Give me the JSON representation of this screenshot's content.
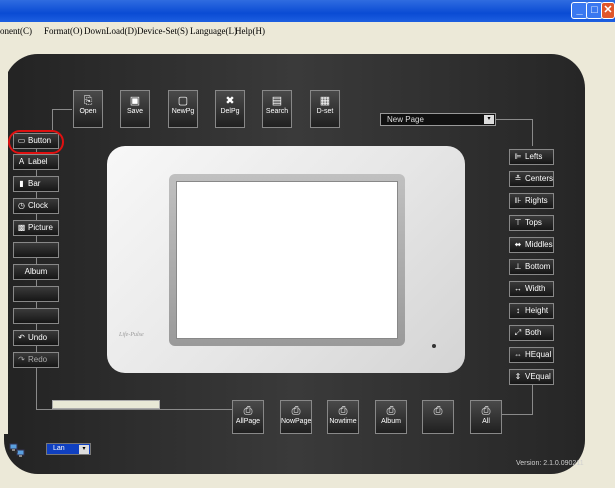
{
  "titlebar": {
    "min": "_",
    "max": "□",
    "close": "✕"
  },
  "menu": [
    "onent(C)",
    "Format(O)",
    "DownLoad(D)",
    "Device-Set(S)",
    "Language(L)",
    "Help(H)"
  ],
  "toolbar_top": [
    {
      "label": "Open",
      "icon": "⎘"
    },
    {
      "label": "Save",
      "icon": "▣"
    },
    {
      "label": "NewPg",
      "icon": "▢"
    },
    {
      "label": "DelPg",
      "icon": "✖"
    },
    {
      "label": "Search",
      "icon": "▤"
    },
    {
      "label": "D-set",
      "icon": "▦"
    }
  ],
  "page_select": {
    "value": "New Page",
    "arrow": "▾"
  },
  "left_items": [
    {
      "label": "Button",
      "icon": "▭"
    },
    {
      "label": "Label",
      "icon": "A"
    },
    {
      "label": "Bar",
      "icon": "▮"
    },
    {
      "label": "Clock",
      "icon": "◷"
    },
    {
      "label": "Picture",
      "icon": "▩"
    },
    {
      "label": "",
      "icon": ""
    },
    {
      "label": "Album",
      "icon": ""
    },
    {
      "label": "",
      "icon": ""
    },
    {
      "label": "",
      "icon": ""
    },
    {
      "label": "Undo",
      "icon": "↶"
    },
    {
      "label": "Redo",
      "icon": "↷"
    }
  ],
  "right_items": [
    {
      "label": "Lefts",
      "icon": "⊫"
    },
    {
      "label": "Centers",
      "icon": "≛"
    },
    {
      "label": "Rights",
      "icon": "⊪"
    },
    {
      "label": "Tops",
      "icon": "⊤"
    },
    {
      "label": "Middles",
      "icon": "⬌"
    },
    {
      "label": "Bottom",
      "icon": "⊥"
    },
    {
      "label": "Width",
      "icon": "↔"
    },
    {
      "label": "Height",
      "icon": "↕"
    },
    {
      "label": "Both",
      "icon": "⤢"
    },
    {
      "label": "HEqual",
      "icon": "⇔"
    },
    {
      "label": "VEqual",
      "icon": "⇕"
    }
  ],
  "toolbar_bottom": [
    {
      "label": "AllPage",
      "icon": "⎙"
    },
    {
      "label": "NowPage",
      "icon": "⎙"
    },
    {
      "label": "Nowtime",
      "icon": "⎙"
    },
    {
      "label": "Album",
      "icon": "⎙"
    },
    {
      "label": "",
      "icon": "⎙"
    },
    {
      "label": "All",
      "icon": "⎙"
    }
  ],
  "device": {
    "brand": "Life-Pulse"
  },
  "connection": {
    "value": "Lan",
    "arrow": "▾"
  },
  "version": "Version: 2.1.0.090211",
  "accent": "#e01010"
}
